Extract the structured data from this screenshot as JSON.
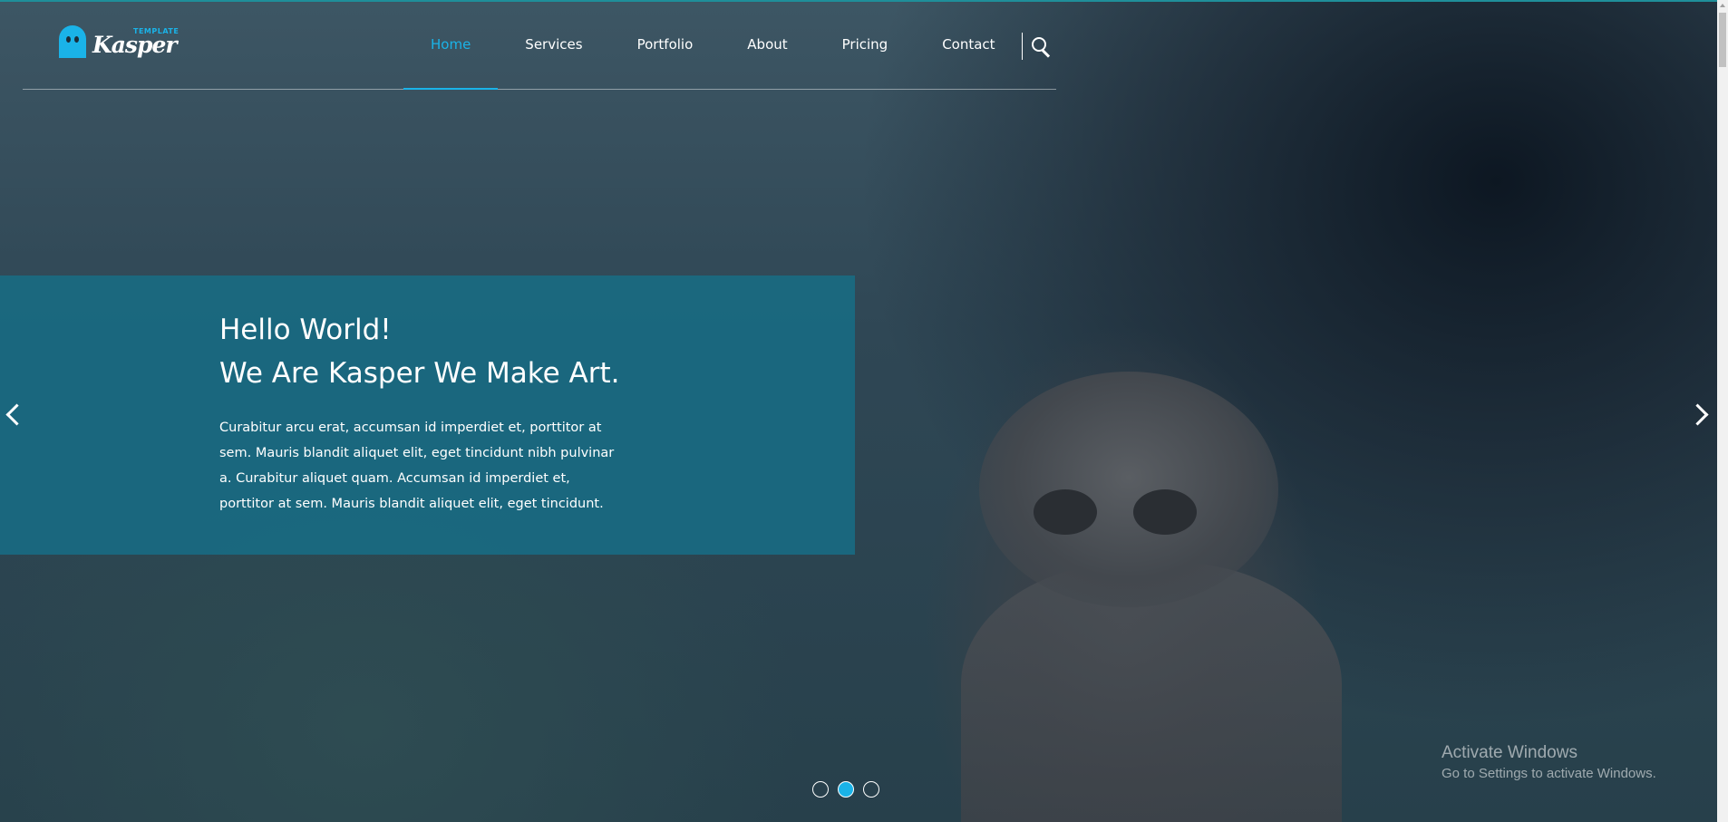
{
  "brand": {
    "name": "Kasper",
    "tagline": "TEMPLATE"
  },
  "nav": {
    "items": [
      {
        "label": "Home",
        "active": true
      },
      {
        "label": "Services"
      },
      {
        "label": "Portfolio"
      },
      {
        "label": "About"
      },
      {
        "label": "Pricing"
      },
      {
        "label": "Contact"
      }
    ]
  },
  "slider": {
    "heading_line1": "Hello World!",
    "heading_line2": "We Are Kasper We Make Art.",
    "body": "Curabitur arcu erat, accumsan id imperdiet et, porttitor at sem. Mauris blandit aliquet elit, eget tincidunt nibh pulvinar a. Curabitur aliquet quam. Accumsan id imperdiet et, porttitor at sem. Mauris blandit aliquet elit, eget tincidunt.",
    "slide_count": 3,
    "active_slide": 2
  },
  "watermark": {
    "title": "Activate Windows",
    "subtitle": "Go to Settings to activate Windows."
  },
  "colors": {
    "accent": "#1ab3e8",
    "slide_box": "#186c84",
    "text": "#ffffff"
  },
  "icons": [
    "search-icon",
    "chevron-left-icon",
    "chevron-right-icon",
    "ghost-logo-icon"
  ]
}
